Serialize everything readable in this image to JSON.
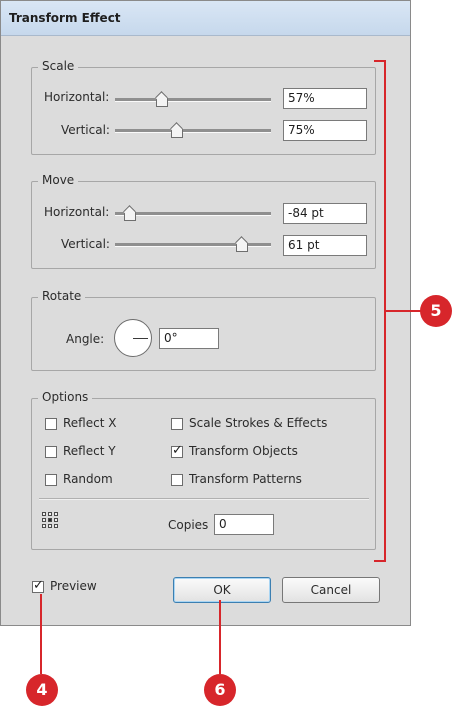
{
  "dialog": {
    "title": "Transform Effect"
  },
  "scale": {
    "legend": "Scale",
    "horizontal": {
      "label": "Horizontal:",
      "value": "57%"
    },
    "vertical": {
      "label": "Vertical:",
      "value": "75%"
    }
  },
  "move": {
    "legend": "Move",
    "horizontal": {
      "label": "Horizontal:",
      "value": "-84 pt"
    },
    "vertical": {
      "label": "Vertical:",
      "value": "61 pt"
    }
  },
  "rotate": {
    "legend": "Rotate",
    "angle_label": "Angle:",
    "angle_value": "0°"
  },
  "options": {
    "legend": "Options",
    "reflect_x": {
      "label": "Reflect X",
      "checked": false
    },
    "reflect_y": {
      "label": "Reflect Y",
      "checked": false
    },
    "random": {
      "label": "Random",
      "checked": false
    },
    "scale_strokes": {
      "label": "Scale Strokes & Effects",
      "checked": false
    },
    "transform_objects": {
      "label": "Transform Objects",
      "checked": true
    },
    "transform_patterns": {
      "label": "Transform Patterns",
      "checked": false
    },
    "copies_label": "Copies",
    "copies_value": "0"
  },
  "footer": {
    "preview_label": "Preview",
    "preview_checked": true,
    "ok_label": "OK",
    "cancel_label": "Cancel"
  },
  "callouts": {
    "four": "4",
    "five": "5",
    "six": "6"
  },
  "colors": {
    "callout": "#d7262b",
    "dialog_bg": "#dcdcdc"
  }
}
